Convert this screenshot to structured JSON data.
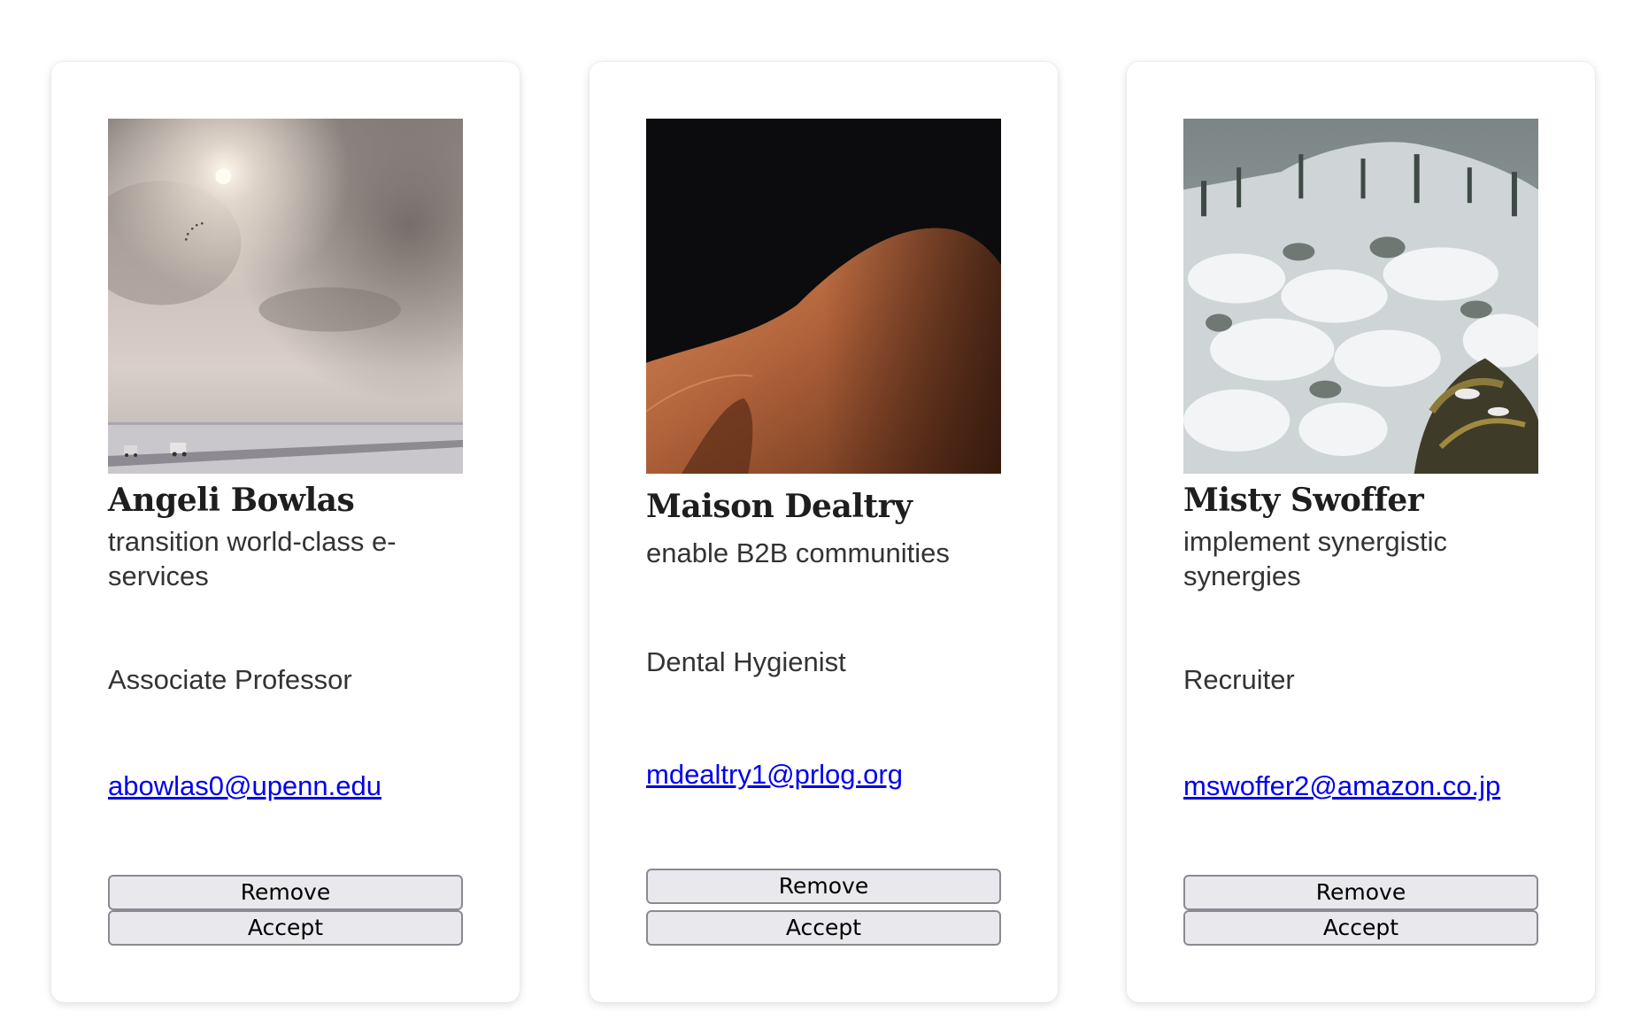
{
  "cards": [
    {
      "name": "Angeli Bowlas",
      "tagline": "transition world-class e-services",
      "job_title": "Associate Professor",
      "email": "abowlas0@upenn.edu",
      "remove_label": "Remove",
      "accept_label": "Accept",
      "photo": "misty-road-photo"
    },
    {
      "name": "Maison Dealtry",
      "tagline": "enable B2B communities",
      "job_title": "Dental Hygienist",
      "email": "mdealtry1@prlog.org",
      "remove_label": "Remove",
      "accept_label": "Accept",
      "photo": "sand-dune-photo"
    },
    {
      "name": "Misty Swoffer",
      "tagline": "implement synergistic synergies",
      "job_title": "Recruiter",
      "email": "mswoffer2@amazon.co.jp",
      "remove_label": "Remove",
      "accept_label": "Accept",
      "photo": "snowy-forest-photo"
    }
  ],
  "colors": {
    "link": "#0000ee",
    "button_bg": "#e9e9ed",
    "button_border": "#8a8a92",
    "text": "#333333",
    "name": "#1e1e1e"
  }
}
